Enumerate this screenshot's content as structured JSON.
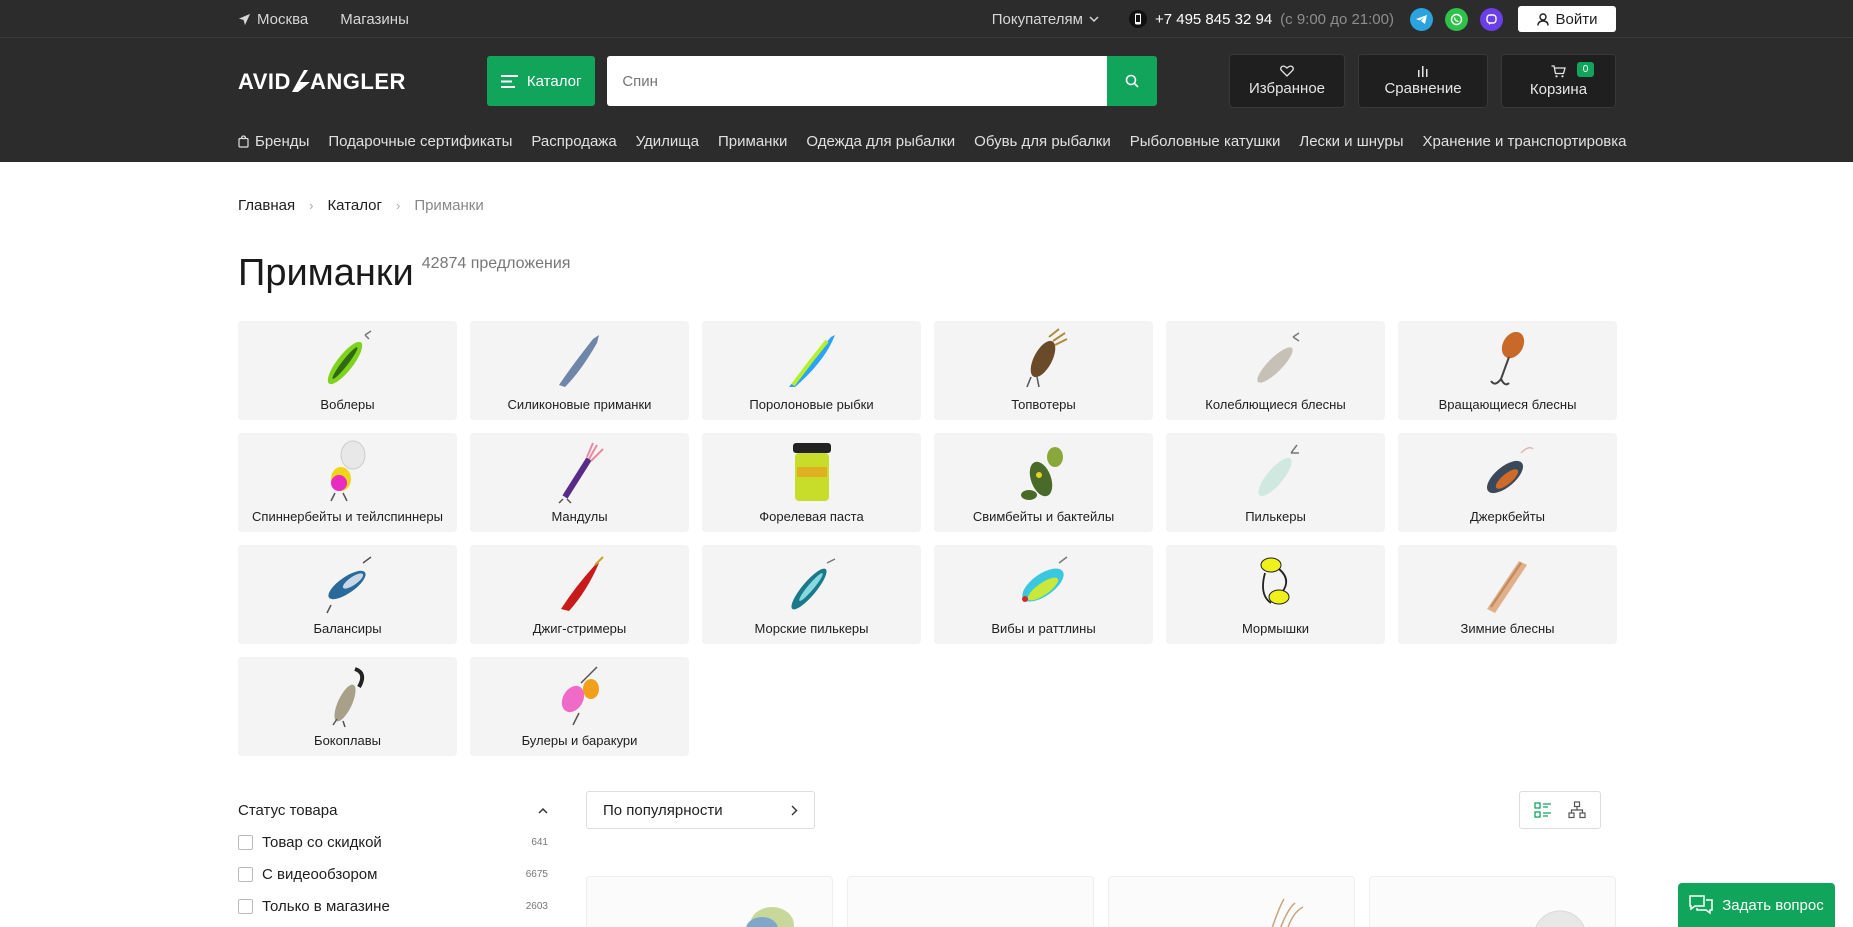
{
  "topbar": {
    "city": "Москва",
    "stores": "Магазины",
    "buyers": "Покупателям",
    "phone": "+7 495 845 32 94",
    "hours": "(с 9:00 до 21:00)",
    "login": "Войти"
  },
  "header": {
    "logo": "AVID ANGLER",
    "catalog": "Каталог",
    "search_placeholder": "Спин",
    "favorites": "Избранное",
    "compare": "Сравнение",
    "cart": "Корзина",
    "cart_count": "0"
  },
  "nav": [
    "Бренды",
    "Подарочные сертификаты",
    "Распродажа",
    "Удилища",
    "Приманки",
    "Одежда для рыбалки",
    "Обувь для рыбалки",
    "Рыболовные катушки",
    "Лески и шнуры",
    "Хранение и транспортировка"
  ],
  "breadcrumb": [
    "Главная",
    "Каталог",
    "Приманки"
  ],
  "page": {
    "title": "Приманки",
    "count": "42874 предложения"
  },
  "categories": [
    {
      "label": "Воблеры",
      "icon": "wobbler-icon"
    },
    {
      "label": "Силиконовые приманки",
      "icon": "soft-bait-icon"
    },
    {
      "label": "Поролоновые рыбки",
      "icon": "foam-fish-icon"
    },
    {
      "label": "Топвотеры",
      "icon": "topwater-icon"
    },
    {
      "label": "Колеблющиеся блесны",
      "icon": "spoon-icon"
    },
    {
      "label": "Вращающиеся блесны",
      "icon": "spinner-icon"
    },
    {
      "label": "Спиннербейты и тейлспиннеры",
      "icon": "spinnerbait-icon"
    },
    {
      "label": "Мандулы",
      "icon": "mandula-icon"
    },
    {
      "label": "Форелевая паста",
      "icon": "trout-paste-icon"
    },
    {
      "label": "Свимбейты и бактейлы",
      "icon": "swimbait-icon"
    },
    {
      "label": "Пилькеры",
      "icon": "pilker-icon"
    },
    {
      "label": "Джеркбейты",
      "icon": "jerkbait-icon"
    },
    {
      "label": "Балансиры",
      "icon": "balancer-icon"
    },
    {
      "label": "Джиг-стримеры",
      "icon": "jig-streamer-icon"
    },
    {
      "label": "Морские пилькеры",
      "icon": "sea-pilker-icon"
    },
    {
      "label": "Вибы и раттлины",
      "icon": "vib-icon"
    },
    {
      "label": "Мормышки",
      "icon": "mormyshka-icon"
    },
    {
      "label": "Зимние блесны",
      "icon": "winter-spoon-icon"
    },
    {
      "label": "Бокоплавы",
      "icon": "amphipod-icon"
    },
    {
      "label": "Булеры и баракури",
      "icon": "buller-icon"
    }
  ],
  "filters": {
    "title": "Статус товара",
    "items": [
      {
        "label": "Товар со скидкой",
        "count": "641"
      },
      {
        "label": "С видеообзором",
        "count": "6675"
      },
      {
        "label": "Только в магазине",
        "count": "2603"
      }
    ]
  },
  "sort": {
    "label": "По популярности"
  },
  "ask": {
    "label": "Задать вопрос"
  },
  "colors": {
    "accent": "#10a55b",
    "dark": "#2c2c2c"
  }
}
